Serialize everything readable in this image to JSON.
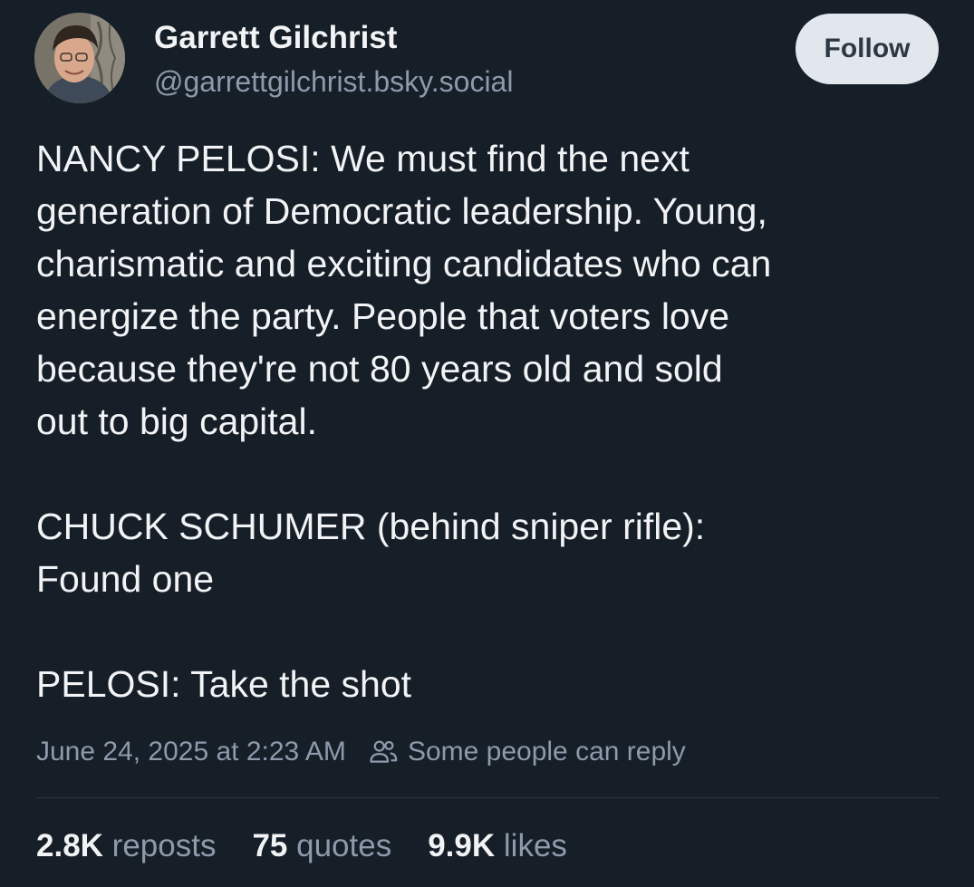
{
  "author": {
    "name": "Garrett Gilchrist",
    "handle": "@garrettgilchrist.bsky.social"
  },
  "follow_label": "Follow",
  "post": {
    "paragraphs": [
      "NANCY PELOSI: We must find the next\ngeneration of Democratic leadership. Young,\ncharismatic and exciting candidates who can\nenergize the party. People that voters love\nbecause they're not 80 years old and sold\nout to big capital.",
      "CHUCK SCHUMER (behind sniper rifle):\nFound one",
      "PELOSI: Take the shot"
    ]
  },
  "meta": {
    "timestamp": "June 24, 2025 at 2:23 AM",
    "reply_setting": "Some people can reply",
    "reply_icon": "people-icon"
  },
  "stats": [
    {
      "count": "2.8K",
      "label": "reposts"
    },
    {
      "count": "75",
      "label": "quotes"
    },
    {
      "count": "9.9K",
      "label": "likes"
    }
  ],
  "colors": {
    "background": "#161e27",
    "text_primary": "#f1f3f5",
    "text_secondary": "#8d9aab",
    "follow_button_bg": "#e2e7ee",
    "follow_button_text": "#2e3843",
    "divider": "#2c3744"
  }
}
